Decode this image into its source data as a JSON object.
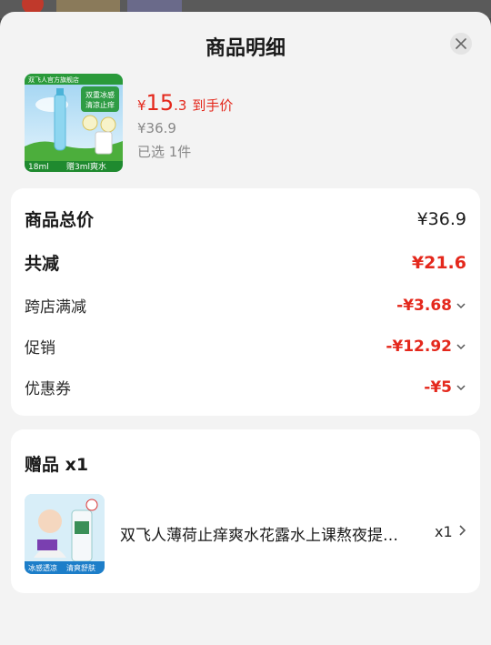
{
  "sheet": {
    "title": "商品明细"
  },
  "product": {
    "currency": "¥",
    "price_int": "15",
    "price_dec": ".3",
    "price_tag": "到手价",
    "original_price": "¥36.9",
    "selected_count": "已选 1件",
    "image_text": {
      "volume": "18ml",
      "gift_banner": "赠3ml爽水",
      "headline": "双重冰感 清凉止痒",
      "brand_strip": "双飞人官方旗舰店"
    }
  },
  "summary": {
    "total_label": "商品总价",
    "total_value": "¥36.9",
    "reduce_label": "共减",
    "reduce_value": "¥21.6",
    "items": [
      {
        "label": "跨店满减",
        "value": "-¥3.68"
      },
      {
        "label": "促销",
        "value": "-¥12.92"
      },
      {
        "label": "优惠券",
        "value": "-¥5"
      }
    ]
  },
  "gift": {
    "title": "赠品 x1",
    "name": "双飞人薄荷止痒爽水花露水上课熬夜提神醒脑",
    "qty": "x1",
    "image_text": {
      "left": "冰感透凉",
      "right": "清爽舒肤"
    }
  },
  "colors": {
    "accent_red": "#e4281c",
    "sheet_bg": "#f3f3f3",
    "card_bg": "#ffffff"
  }
}
